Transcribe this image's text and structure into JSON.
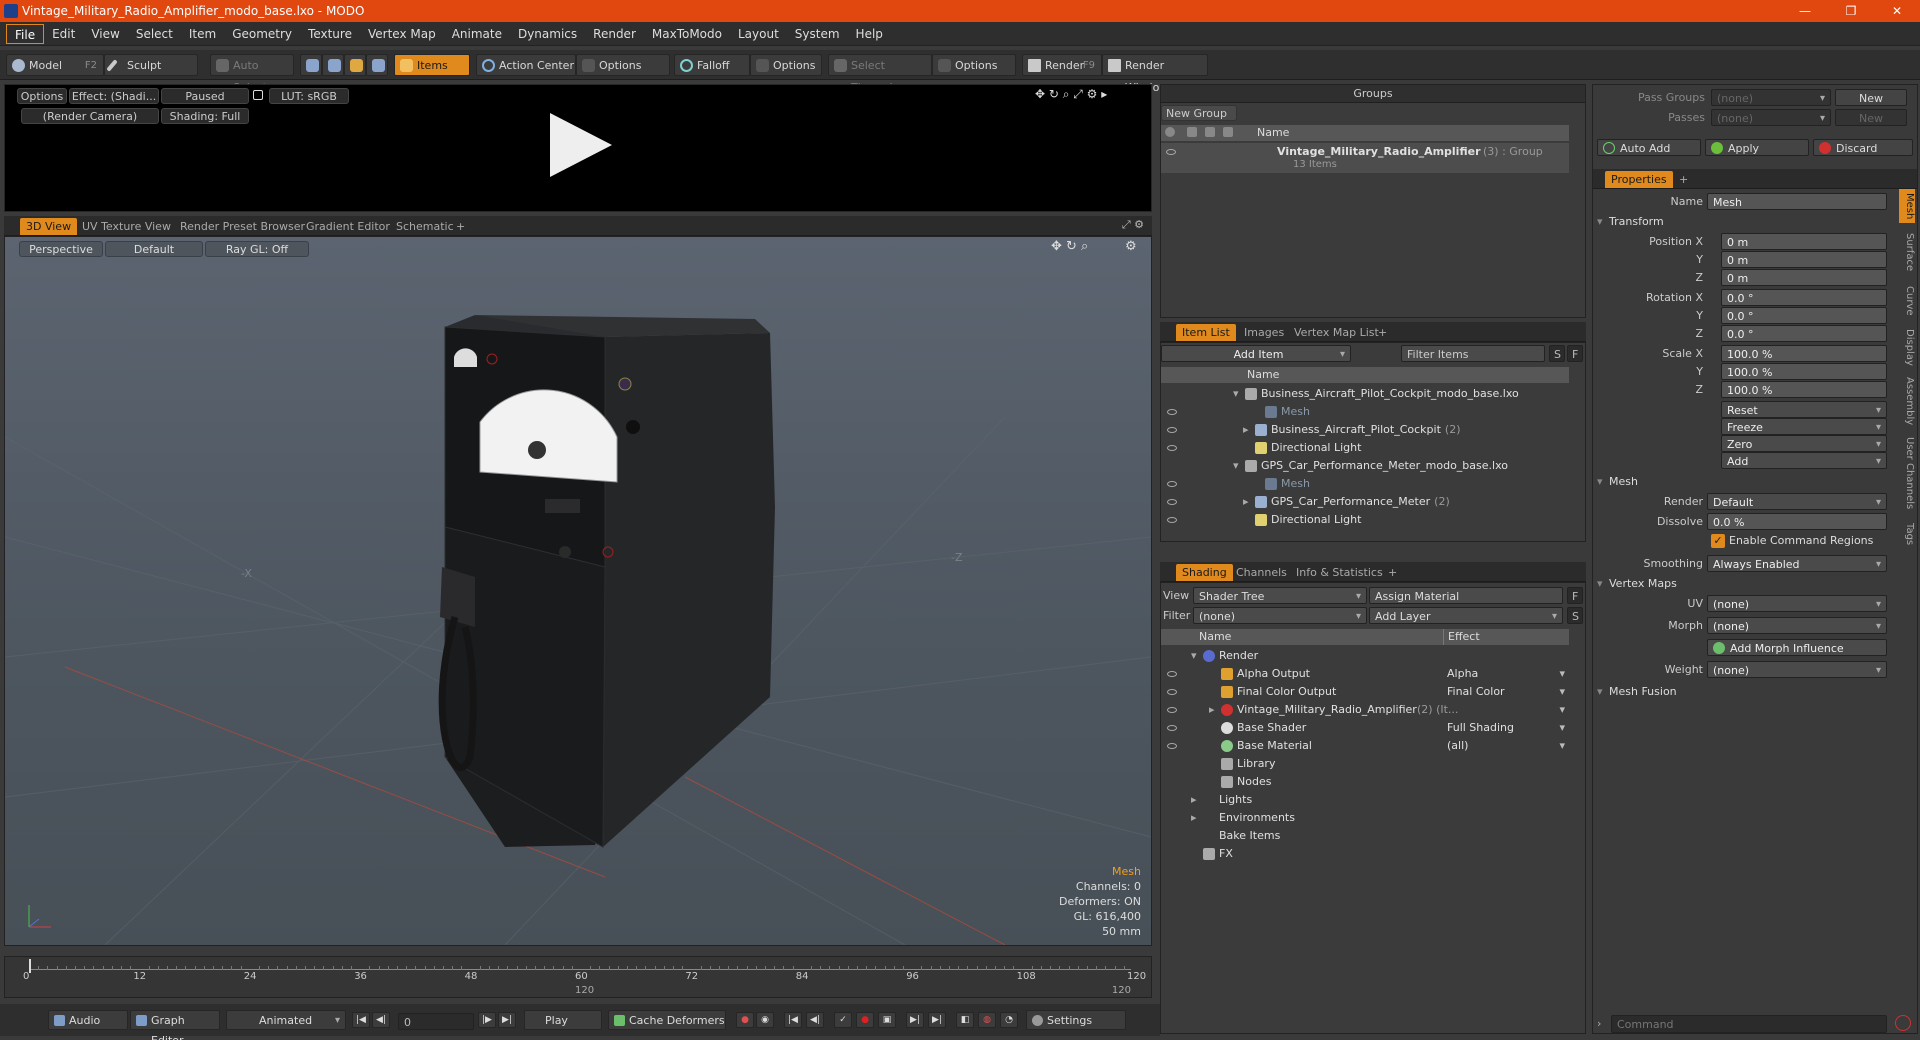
{
  "window": {
    "title": "Vintage_Military_Radio_Amplifier_modo_base.lxo - MODO",
    "minimize": "—",
    "maximize": "❐",
    "close": "✕"
  },
  "menu": [
    "File",
    "Edit",
    "View",
    "Select",
    "Item",
    "Geometry",
    "Texture",
    "Vertex Map",
    "Animate",
    "Dynamics",
    "Render",
    "MaxToModo",
    "Layout",
    "System",
    "Help"
  ],
  "toolbar": {
    "model": "Model",
    "model_key": "F2",
    "sculpt": "Sculpt",
    "auto_select": "Auto Select",
    "items": "Items",
    "action_center": "Action Center",
    "options1": "Options",
    "falloff": "Falloff",
    "options2": "Options",
    "select_through": "Select Through",
    "options3": "Options",
    "render": "Render",
    "render_key": "F9",
    "render_window": "Render Window"
  },
  "preview": {
    "options": "Options",
    "effect": "Effect: (Shadi...",
    "paused": "Paused",
    "lut": "LUT: sRGB",
    "camera": "(Render Camera)",
    "shading": "Shading: Full"
  },
  "viewport_tabs": [
    "3D View",
    "UV Texture View",
    "Render Preset Browser",
    "Gradient Editor",
    "Schematic",
    "+"
  ],
  "viewport": {
    "perspective": "Perspective",
    "default": "Default",
    "raygl": "Ray GL: Off",
    "axis_x": "-X",
    "axis_z": "-Z",
    "hud": {
      "mesh": "Mesh",
      "channels": "Channels: 0",
      "deformers": "Deformers: ON",
      "gl": "GL: 616,400",
      "focal": "50 mm"
    }
  },
  "timeline": {
    "ticks": [
      "0",
      "12",
      "24",
      "36",
      "48",
      "60",
      "72",
      "84",
      "96",
      "108",
      "120"
    ],
    "mid": "120",
    "end": "120"
  },
  "bottombar": {
    "audio": "Audio",
    "graph_editor": "Graph Editor",
    "animated": "Animated",
    "frame": "0",
    "play": "Play",
    "cache_deformers": "Cache Deformers",
    "settings": "Settings"
  },
  "groups": {
    "title": "Groups",
    "new_group": "New Group",
    "col_name": "Name",
    "item_name": "Vintage_Military_Radio_Amplifier",
    "item_suffix": "(3) : Group",
    "item_count": "13 Items"
  },
  "itemlist": {
    "tabs": [
      "Item List",
      "Images",
      "Vertex Map List",
      "+"
    ],
    "add_item": "Add Item",
    "filter": "Filter Items",
    "s": "S",
    "f": "F",
    "col_name": "Name",
    "rows": [
      {
        "label": "Business_Aircraft_Pilot_Cockpit_modo_base.lxo",
        "indent": 0,
        "kind": "scene"
      },
      {
        "label": "Mesh",
        "indent": 2,
        "kind": "mesh-dim"
      },
      {
        "label": "Business_Aircraft_Pilot_Cockpit",
        "suffix": "(2)",
        "indent": 1,
        "kind": "group"
      },
      {
        "label": "Directional Light",
        "indent": 1,
        "kind": "light"
      },
      {
        "label": "GPS_Car_Performance_Meter_modo_base.lxo",
        "indent": 0,
        "kind": "scene"
      },
      {
        "label": "Mesh",
        "indent": 2,
        "kind": "mesh-dim"
      },
      {
        "label": "GPS_Car_Performance_Meter",
        "suffix": "(2)",
        "indent": 1,
        "kind": "group"
      },
      {
        "label": "Directional Light",
        "indent": 1,
        "kind": "light"
      }
    ]
  },
  "shading": {
    "tabs": [
      "Shading",
      "Channels",
      "Info & Statistics",
      "+"
    ],
    "view_label": "View",
    "view_value": "Shader Tree",
    "assign_material": "Assign Material",
    "f": "F",
    "filter_label": "Filter",
    "filter_value": "(none)",
    "add_layer": "Add Layer",
    "s": "S",
    "col_name": "Name",
    "col_effect": "Effect",
    "rows": [
      {
        "label": "Render",
        "effect": "",
        "indent": 0
      },
      {
        "label": "Alpha Output",
        "effect": "Alpha",
        "indent": 1
      },
      {
        "label": "Final Color Output",
        "effect": "Final Color",
        "indent": 1
      },
      {
        "label": "Vintage_Military_Radio_Amplifier",
        "suffix": "(2) (It...",
        "effect": "",
        "indent": 1
      },
      {
        "label": "Base Shader",
        "effect": "Full Shading",
        "indent": 1
      },
      {
        "label": "Base Material",
        "effect": "(all)",
        "indent": 1
      },
      {
        "label": "Library",
        "effect": "",
        "indent": 1
      },
      {
        "label": "Nodes",
        "effect": "",
        "indent": 1
      },
      {
        "label": "Lights",
        "effect": "",
        "indent": 0
      },
      {
        "label": "Environments",
        "effect": "",
        "indent": 0
      },
      {
        "label": "Bake Items",
        "effect": "",
        "indent": 0
      },
      {
        "label": "FX",
        "effect": "",
        "indent": 0
      }
    ]
  },
  "passes": {
    "pass_groups": "Pass Groups",
    "passes": "Passes",
    "none": "(none)",
    "new": "New",
    "auto_add": "Auto Add",
    "apply": "Apply",
    "discard": "Discard"
  },
  "properties": {
    "tab": "Properties",
    "plus": "+",
    "name_label": "Name",
    "name_value": "Mesh",
    "transform": "Transform",
    "position_x": "Position X",
    "y": "Y",
    "z": "Z",
    "rotation_x": "Rotation X",
    "scale_x": "Scale X",
    "pos": [
      "0 m",
      "0 m",
      "0 m"
    ],
    "rot": [
      "0.0 °",
      "0.0 °",
      "0.0 °"
    ],
    "scl": [
      "100.0 %",
      "100.0 %",
      "100.0 %"
    ],
    "reset": "Reset",
    "freeze": "Freeze",
    "zero": "Zero",
    "add": "Add",
    "mesh": "Mesh",
    "render_label": "Render",
    "render_value": "Default",
    "dissolve_label": "Dissolve",
    "dissolve_value": "0.0 %",
    "enable_cmd": "Enable Command Regions",
    "smoothing_label": "Smoothing",
    "smoothing_value": "Always Enabled",
    "vertex_maps": "Vertex Maps",
    "uv_label": "UV",
    "uv_value": "(none)",
    "morph_label": "Morph",
    "morph_value": "(none)",
    "add_morph": "Add Morph Influence",
    "weight_label": "Weight",
    "weight_value": "(none)",
    "mesh_fusion": "Mesh Fusion",
    "side_tabs": [
      "Mesh",
      "Surface",
      "Curve",
      "Display",
      "Assembly",
      "User Channels",
      "Tags"
    ]
  },
  "command": {
    "placeholder": "Command"
  },
  "colors": {
    "accent": "#e08a1d",
    "titlebar": "#e0480f"
  }
}
